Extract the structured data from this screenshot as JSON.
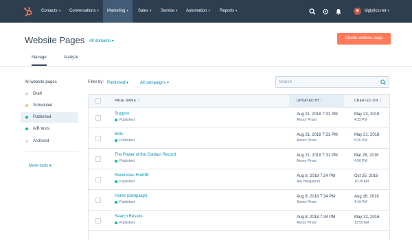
{
  "topnav": {
    "items": [
      {
        "label": "Contacts",
        "active": false
      },
      {
        "label": "Conversations",
        "active": false
      },
      {
        "label": "Marketing",
        "active": true
      },
      {
        "label": "Sales",
        "active": false
      },
      {
        "label": "Service",
        "active": false
      },
      {
        "label": "Automation",
        "active": false
      },
      {
        "label": "Reports",
        "active": false
      }
    ],
    "account": "biglytics.net",
    "icons": [
      "sprocket-logo-icon",
      "search-icon",
      "gear-icon",
      "bell-icon"
    ]
  },
  "header": {
    "title": "Website Pages",
    "domains": "All domains",
    "create_button": "Create website page"
  },
  "tabs": [
    {
      "label": "Manage",
      "active": true
    },
    {
      "label": "Analyze",
      "active": false
    }
  ],
  "sidebar": {
    "title": "All website pages",
    "items": [
      {
        "label": "Draft",
        "dot": "#cbd6e2",
        "active": false
      },
      {
        "label": "Scheduled",
        "dot": "#f5c26b",
        "active": false
      },
      {
        "label": "Published",
        "dot": "#00bda5",
        "active": true
      },
      {
        "label": "A/B tests",
        "dot": "#00bda5",
        "active": false
      },
      {
        "label": "Archived",
        "dot": "#ffffff",
        "active": false
      }
    ],
    "more_tools": "More tools"
  },
  "filters": {
    "label": "Filter by:",
    "status": "Published",
    "campaigns": "All campaigns",
    "search_placeholder": "Search"
  },
  "table": {
    "columns": [
      "PAGE NAME",
      "UPDATED BY",
      "CREATED ON"
    ],
    "rows": [
      {
        "name": "Support",
        "status": "Published",
        "updated": "Aug 21, 2018 7:31 PM",
        "author": "Alnoor Pirani",
        "created": "May 23, 2018",
        "time": "4:22 PM"
      },
      {
        "name": "Bots",
        "status": "Published",
        "updated": "Aug 21, 2018 7:31 PM",
        "author": "Alnoor Pirani",
        "created": "May 21, 2018",
        "time": "5:26 PM"
      },
      {
        "name": "The Power of the Contact Record",
        "status": "Published",
        "updated": "Aug 21, 2018 7:31 PM",
        "author": "Alnoor Pirani",
        "created": "Mar 26, 2018",
        "time": "4:56 PM"
      },
      {
        "name": "Resources HubDB",
        "status": "Published",
        "updated": "Aug 8, 2018 7:34 PM",
        "author": "Ally Hangartner",
        "created": "Oct 25, 2016",
        "time": "10:39 AM"
      },
      {
        "name": "Home (campaign)",
        "status": "Published",
        "updated": "Aug 8, 2018 7:34 PM",
        "author": "Alnoor Pirani",
        "created": "Aug 16, 2016",
        "time": "4:19 PM"
      },
      {
        "name": "Search Results",
        "status": "Published",
        "updated": "Aug 8, 2018 7:34 PM",
        "author": "Alnoor Pirani",
        "created": "May 22, 2016",
        "time": "12:50 AM"
      }
    ]
  },
  "colors": {
    "nav_bg": "#2d3e50",
    "accent_orange": "#ff7a59",
    "link_teal": "#0091ae",
    "published_green": "#00bda5"
  }
}
